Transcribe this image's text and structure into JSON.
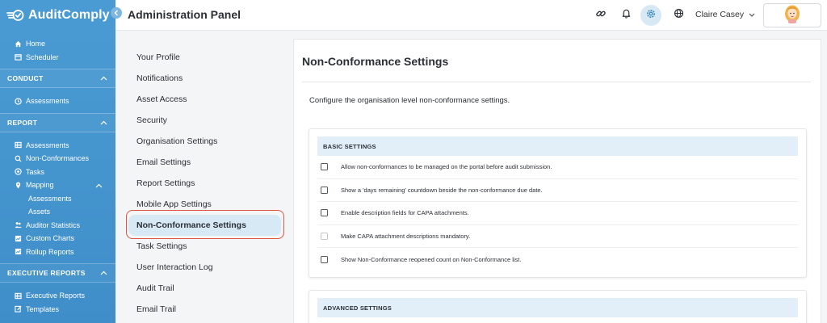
{
  "app": {
    "name": "AuditComply"
  },
  "header": {
    "title": "Administration Panel",
    "user_name": "Claire Casey",
    "icons": [
      "link-icon",
      "bell-icon",
      "gear-icon",
      "globe-icon"
    ]
  },
  "sidebar": {
    "top_items": [
      {
        "label": "Home",
        "icon": "home-icon"
      },
      {
        "label": "Scheduler",
        "icon": "calendar-icon"
      }
    ],
    "conduct": {
      "title": "CONDUCT",
      "items": [
        {
          "label": "Assessments",
          "icon": "clock-icon"
        }
      ]
    },
    "report": {
      "title": "REPORT",
      "items": [
        {
          "label": "Assessments",
          "icon": "table-icon"
        },
        {
          "label": "Non-Conformances",
          "icon": "search-icon"
        },
        {
          "label": "Tasks",
          "icon": "task-icon"
        },
        {
          "label": "Mapping",
          "icon": "pin-icon"
        },
        {
          "label": "Assessments",
          "icon": ""
        },
        {
          "label": "Assets",
          "icon": ""
        },
        {
          "label": "Auditor Statistics",
          "icon": "users-icon"
        },
        {
          "label": "Custom Charts",
          "icon": "chart-icon"
        },
        {
          "label": "Rollup Reports",
          "icon": "chart-icon"
        }
      ]
    },
    "executive": {
      "title": "EXECUTIVE REPORTS",
      "items": [
        {
          "label": "Executive Reports",
          "icon": "table-icon"
        },
        {
          "label": "Templates",
          "icon": "edit-icon"
        }
      ]
    }
  },
  "settings_menu": {
    "items": [
      "Your Profile",
      "Notifications",
      "Asset Access",
      "Security",
      "Organisation Settings",
      "Email Settings",
      "Report Settings",
      "Mobile App Settings",
      "Non-Conformance Settings",
      "Task Settings",
      "User Interaction Log",
      "Audit Trail",
      "Email Trail"
    ],
    "active_index": 8
  },
  "main": {
    "title": "Non-Conformance Settings",
    "description": "Configure the organisation level non-conformance settings.",
    "basic": {
      "title": "BASIC SETTINGS",
      "options": [
        {
          "label": "Allow non-conformances to be managed on the portal before audit submission.",
          "checked": false,
          "disabled": false
        },
        {
          "label": "Show a 'days remaining' countdown beside the non-conformance due date.",
          "checked": false,
          "disabled": false
        },
        {
          "label": "Enable description fields for CAPA attachments.",
          "checked": false,
          "disabled": false
        },
        {
          "label": "Make CAPA attachment descriptions mandatory.",
          "checked": false,
          "disabled": true
        },
        {
          "label": "Show Non-Conformance reopened count on Non-Conformance list.",
          "checked": false,
          "disabled": false
        }
      ]
    },
    "advanced": {
      "title": "ADVANCED SETTINGS"
    }
  },
  "colors": {
    "sidebar": "#4a9bd4",
    "accent": "#d8e9f6",
    "highlight": "#e0533f",
    "section_head": "#e2eef8"
  }
}
